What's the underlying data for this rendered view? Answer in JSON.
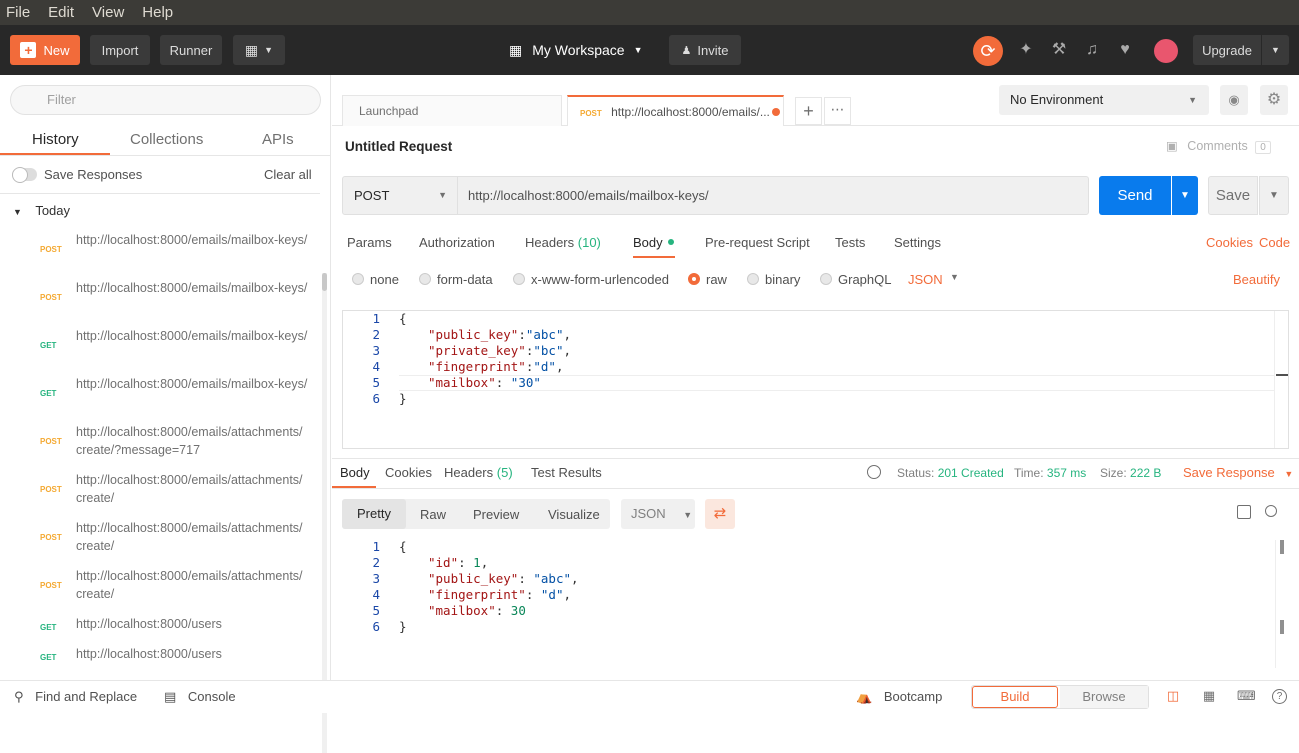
{
  "menubar": {
    "items": [
      "File",
      "Edit",
      "View",
      "Help"
    ]
  },
  "header": {
    "new_label": "New",
    "import_label": "Import",
    "runner_label": "Runner",
    "workspace_label": "My Workspace",
    "invite_label": "Invite",
    "upgrade_label": "Upgrade"
  },
  "sidebar": {
    "filter_placeholder": "Filter",
    "tabs": {
      "history": "History",
      "collections": "Collections",
      "apis": "APIs"
    },
    "save_responses_label": "Save Responses",
    "clear_all_label": "Clear all",
    "group_label": "Today",
    "history": [
      {
        "method": "POST",
        "url": "http://localhost:8000/emails/mailbox-keys/"
      },
      {
        "method": "POST",
        "url": "http://localhost:8000/emails/mailbox-keys/"
      },
      {
        "method": "GET",
        "url": "http://localhost:8000/emails/mailbox-keys/"
      },
      {
        "method": "GET",
        "url": "http://localhost:8000/emails/mailbox-keys/"
      },
      {
        "method": "POST",
        "url": "http://localhost:8000/emails/attachments/create/?message=717"
      },
      {
        "method": "POST",
        "url": "http://localhost:8000/emails/attachments/create/"
      },
      {
        "method": "POST",
        "url": "http://localhost:8000/emails/attachments/create/"
      },
      {
        "method": "POST",
        "url": "http://localhost:8000/emails/attachments/create/"
      },
      {
        "method": "GET",
        "url": "http://localhost:8000/users"
      },
      {
        "method": "GET",
        "url": "http://localhost:8000/users"
      }
    ],
    "colors": {
      "POST": "#f4a932",
      "GET": "#26b47f"
    }
  },
  "tabs": {
    "launchpad": "Launchpad",
    "request_method": "POST",
    "request_url": "http://localhost:8000/emails/..."
  },
  "environment": {
    "selected": "No Environment"
  },
  "request": {
    "title": "Untitled Request",
    "comments_label": "Comments",
    "comments_count": "0",
    "method": "POST",
    "url": "http://localhost:8000/emails/mailbox-keys/",
    "send_label": "Send",
    "save_label": "Save",
    "tabs": {
      "params": "Params",
      "authorization": "Authorization",
      "headers": "Headers",
      "headers_count": "(10)",
      "body": "Body",
      "pre_request": "Pre-request Script",
      "tests": "Tests",
      "settings": "Settings"
    },
    "cookies_label": "Cookies",
    "code_label": "Code",
    "body_types": [
      "none",
      "form-data",
      "x-www-form-urlencoded",
      "raw",
      "binary",
      "GraphQL"
    ],
    "body_selected": "raw",
    "raw_format": "JSON",
    "beautify_label": "Beautify",
    "body_lines": [
      {
        "no": "1",
        "text": "{"
      },
      {
        "no": "2",
        "key": "\"public_key\"",
        "sep": ":",
        "val": "\"abc\"",
        "end": ","
      },
      {
        "no": "3",
        "key": "\"private_key\"",
        "sep": ":",
        "val": "\"bc\"",
        "end": ","
      },
      {
        "no": "4",
        "key": "\"fingerprint\"",
        "sep": ":",
        "val": "\"d\"",
        "end": ","
      },
      {
        "no": "5",
        "key": "\"mailbox\"",
        "sep": ": ",
        "val": "\"30\"",
        "end": ""
      },
      {
        "no": "6",
        "text": "}"
      }
    ]
  },
  "response": {
    "tabs": {
      "body": "Body",
      "cookies": "Cookies",
      "headers": "Headers",
      "headers_count": "(5)",
      "test_results": "Test Results"
    },
    "status_label": "Status:",
    "status_value": "201 Created",
    "time_label": "Time:",
    "time_value": "357 ms",
    "size_label": "Size:",
    "size_value": "222 B",
    "save_response_label": "Save Response",
    "view_tabs": [
      "Pretty",
      "Raw",
      "Preview",
      "Visualize"
    ],
    "format": "JSON",
    "body_lines": [
      {
        "no": "1",
        "text": "{"
      },
      {
        "no": "2",
        "key": "\"id\"",
        "sep": ": ",
        "val": "1",
        "end": ",",
        "num": true
      },
      {
        "no": "3",
        "key": "\"public_key\"",
        "sep": ": ",
        "val": "\"abc\"",
        "end": ","
      },
      {
        "no": "4",
        "key": "\"fingerprint\"",
        "sep": ": ",
        "val": "\"d\"",
        "end": ","
      },
      {
        "no": "5",
        "key": "\"mailbox\"",
        "sep": ": ",
        "val": "30",
        "end": "",
        "num": true
      },
      {
        "no": "6",
        "text": "}"
      }
    ]
  },
  "statusbar": {
    "find_replace": "Find and Replace",
    "console": "Console",
    "bootcamp": "Bootcamp",
    "build": "Build",
    "browse": "Browse"
  }
}
